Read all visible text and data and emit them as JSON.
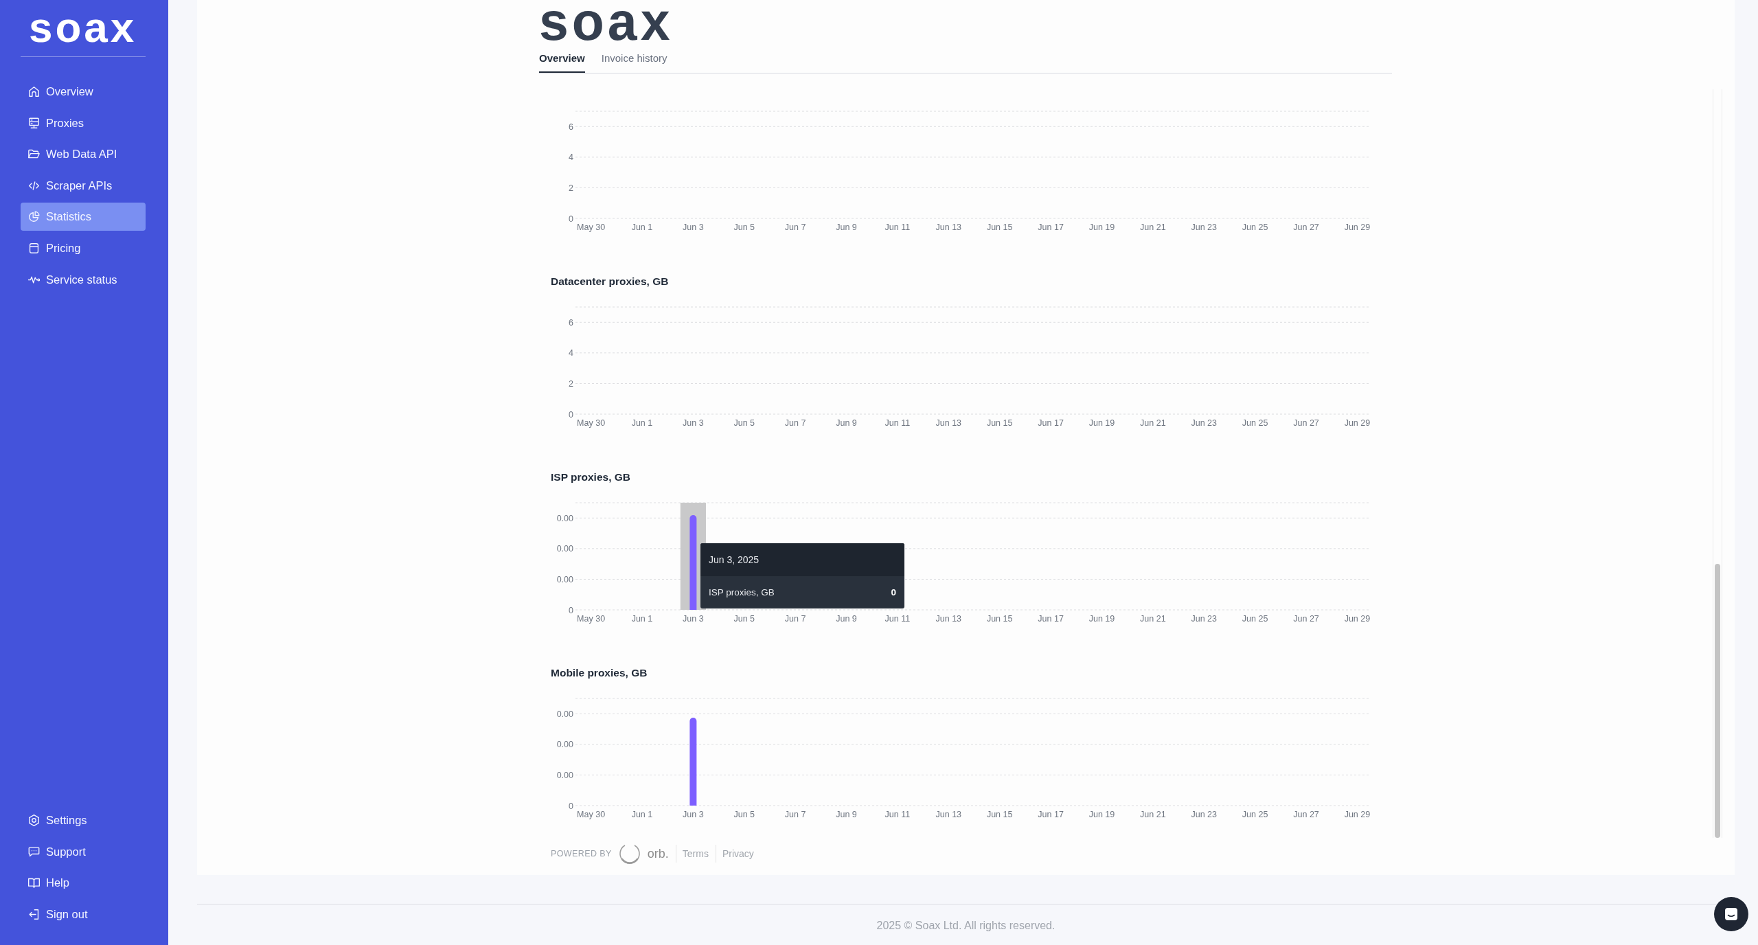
{
  "sidebar": {
    "logo": "soax",
    "items": [
      {
        "label": "Overview",
        "selected": false
      },
      {
        "label": "Proxies",
        "selected": false
      },
      {
        "label": "Web Data API",
        "selected": false
      },
      {
        "label": "Scraper APIs",
        "selected": false
      },
      {
        "label": "Statistics",
        "selected": true
      },
      {
        "label": "Pricing",
        "selected": false
      },
      {
        "label": "Service status",
        "selected": false
      }
    ],
    "bottom_items": [
      {
        "label": "Settings",
        "selected": false
      },
      {
        "label": "Support",
        "selected": false
      },
      {
        "label": "Help",
        "selected": false
      },
      {
        "label": "Sign out",
        "selected": false
      }
    ]
  },
  "header": {
    "logo": "soax",
    "tabs": [
      {
        "label": "Overview",
        "selected": true
      },
      {
        "label": "Invoice history",
        "selected": false
      }
    ]
  },
  "charts": [
    {
      "kind": "data",
      "chart_data": {
        "type": "bar",
        "categories": [
          "May 30",
          "Jun 1",
          "Jun 3",
          "Jun 5",
          "Jun 7",
          "Jun 9",
          "Jun 11",
          "Jun 13",
          "Jun 15",
          "Jun 17",
          "Jun 19",
          "Jun 21",
          "Jun 23",
          "Jun 25",
          "Jun 27",
          "Jun 29"
        ],
        "values": [
          0,
          0,
          0,
          0,
          0,
          0,
          0,
          0,
          0,
          0,
          0,
          0,
          0,
          0,
          0,
          0
        ],
        "ylim": [
          0,
          7
        ],
        "yticks": [
          0,
          2,
          4,
          6
        ],
        "grid": true
      }
    },
    {
      "kind": "data",
      "chart_data": {
        "type": "bar",
        "title": "Datacenter proxies, GB",
        "categories": [
          "May 30",
          "Jun 1",
          "Jun 3",
          "Jun 5",
          "Jun 7",
          "Jun 9",
          "Jun 11",
          "Jun 13",
          "Jun 15",
          "Jun 17",
          "Jun 19",
          "Jun 21",
          "Jun 23",
          "Jun 25",
          "Jun 27",
          "Jun 29"
        ],
        "values": [
          0,
          0,
          0,
          0,
          0,
          0,
          0,
          0,
          0,
          0,
          0,
          0,
          0,
          0,
          0,
          0
        ],
        "ylim": [
          0,
          7
        ],
        "yticks": [
          0,
          2,
          4,
          6
        ],
        "grid": true
      }
    },
    {
      "kind": "picture",
      "title": "ISP proxies, GB",
      "y_labels": [
        "0.00",
        "0.00",
        "0.00",
        "0"
      ],
      "x_labels": [
        "May 30",
        "Jun 1",
        "Jun 3",
        "Jun 5",
        "Jun 7",
        "Jun 9",
        "Jun 11",
        "Jun 13",
        "Jun 15",
        "Jun 17",
        "Jun 19",
        "Jun 21",
        "Jun 23",
        "Jun 25",
        "Jun 27",
        "Jun 29"
      ],
      "tooltip": {
        "date": "Jun 3, 2025",
        "series": "ISP proxies, GB",
        "value": "0"
      }
    },
    {
      "kind": "picture",
      "title": "Mobile proxies, GB",
      "y_labels": [
        "0.00",
        "0.00",
        "0.00",
        "0"
      ],
      "x_labels": [
        "May 30",
        "Jun 1",
        "Jun 3",
        "Jun 5",
        "Jun 7",
        "Jun 9",
        "Jun 11",
        "Jun 13",
        "Jun 15",
        "Jun 17",
        "Jun 19",
        "Jun 21",
        "Jun 23",
        "Jun 25",
        "Jun 27",
        "Jun 29"
      ]
    }
  ],
  "powered_by": {
    "label": "POWERED BY",
    "brand": "orb.",
    "links": [
      "Terms",
      "Privacy"
    ]
  },
  "footer": {
    "copyright": "2025 © Soax Ltd. All rights reserved."
  }
}
